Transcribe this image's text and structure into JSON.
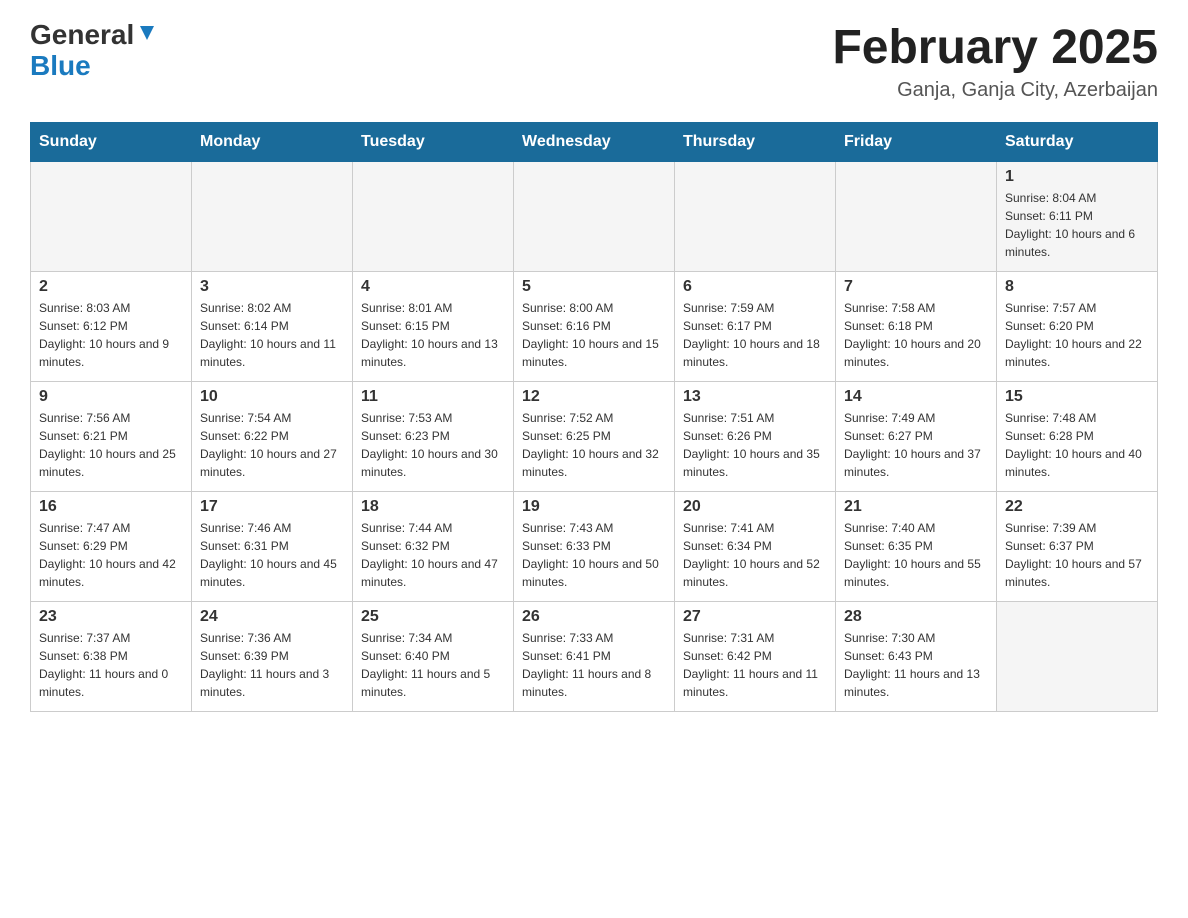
{
  "logo": {
    "general": "General",
    "blue": "Blue"
  },
  "header": {
    "month_year": "February 2025",
    "location": "Ganja, Ganja City, Azerbaijan"
  },
  "days_of_week": [
    "Sunday",
    "Monday",
    "Tuesday",
    "Wednesday",
    "Thursday",
    "Friday",
    "Saturday"
  ],
  "weeks": [
    {
      "days": [
        {
          "number": "",
          "info": ""
        },
        {
          "number": "",
          "info": ""
        },
        {
          "number": "",
          "info": ""
        },
        {
          "number": "",
          "info": ""
        },
        {
          "number": "",
          "info": ""
        },
        {
          "number": "",
          "info": ""
        },
        {
          "number": "1",
          "info": "Sunrise: 8:04 AM\nSunset: 6:11 PM\nDaylight: 10 hours and 6 minutes."
        }
      ]
    },
    {
      "days": [
        {
          "number": "2",
          "info": "Sunrise: 8:03 AM\nSunset: 6:12 PM\nDaylight: 10 hours and 9 minutes."
        },
        {
          "number": "3",
          "info": "Sunrise: 8:02 AM\nSunset: 6:14 PM\nDaylight: 10 hours and 11 minutes."
        },
        {
          "number": "4",
          "info": "Sunrise: 8:01 AM\nSunset: 6:15 PM\nDaylight: 10 hours and 13 minutes."
        },
        {
          "number": "5",
          "info": "Sunrise: 8:00 AM\nSunset: 6:16 PM\nDaylight: 10 hours and 15 minutes."
        },
        {
          "number": "6",
          "info": "Sunrise: 7:59 AM\nSunset: 6:17 PM\nDaylight: 10 hours and 18 minutes."
        },
        {
          "number": "7",
          "info": "Sunrise: 7:58 AM\nSunset: 6:18 PM\nDaylight: 10 hours and 20 minutes."
        },
        {
          "number": "8",
          "info": "Sunrise: 7:57 AM\nSunset: 6:20 PM\nDaylight: 10 hours and 22 minutes."
        }
      ]
    },
    {
      "days": [
        {
          "number": "9",
          "info": "Sunrise: 7:56 AM\nSunset: 6:21 PM\nDaylight: 10 hours and 25 minutes."
        },
        {
          "number": "10",
          "info": "Sunrise: 7:54 AM\nSunset: 6:22 PM\nDaylight: 10 hours and 27 minutes."
        },
        {
          "number": "11",
          "info": "Sunrise: 7:53 AM\nSunset: 6:23 PM\nDaylight: 10 hours and 30 minutes."
        },
        {
          "number": "12",
          "info": "Sunrise: 7:52 AM\nSunset: 6:25 PM\nDaylight: 10 hours and 32 minutes."
        },
        {
          "number": "13",
          "info": "Sunrise: 7:51 AM\nSunset: 6:26 PM\nDaylight: 10 hours and 35 minutes."
        },
        {
          "number": "14",
          "info": "Sunrise: 7:49 AM\nSunset: 6:27 PM\nDaylight: 10 hours and 37 minutes."
        },
        {
          "number": "15",
          "info": "Sunrise: 7:48 AM\nSunset: 6:28 PM\nDaylight: 10 hours and 40 minutes."
        }
      ]
    },
    {
      "days": [
        {
          "number": "16",
          "info": "Sunrise: 7:47 AM\nSunset: 6:29 PM\nDaylight: 10 hours and 42 minutes."
        },
        {
          "number": "17",
          "info": "Sunrise: 7:46 AM\nSunset: 6:31 PM\nDaylight: 10 hours and 45 minutes."
        },
        {
          "number": "18",
          "info": "Sunrise: 7:44 AM\nSunset: 6:32 PM\nDaylight: 10 hours and 47 minutes."
        },
        {
          "number": "19",
          "info": "Sunrise: 7:43 AM\nSunset: 6:33 PM\nDaylight: 10 hours and 50 minutes."
        },
        {
          "number": "20",
          "info": "Sunrise: 7:41 AM\nSunset: 6:34 PM\nDaylight: 10 hours and 52 minutes."
        },
        {
          "number": "21",
          "info": "Sunrise: 7:40 AM\nSunset: 6:35 PM\nDaylight: 10 hours and 55 minutes."
        },
        {
          "number": "22",
          "info": "Sunrise: 7:39 AM\nSunset: 6:37 PM\nDaylight: 10 hours and 57 minutes."
        }
      ]
    },
    {
      "days": [
        {
          "number": "23",
          "info": "Sunrise: 7:37 AM\nSunset: 6:38 PM\nDaylight: 11 hours and 0 minutes."
        },
        {
          "number": "24",
          "info": "Sunrise: 7:36 AM\nSunset: 6:39 PM\nDaylight: 11 hours and 3 minutes."
        },
        {
          "number": "25",
          "info": "Sunrise: 7:34 AM\nSunset: 6:40 PM\nDaylight: 11 hours and 5 minutes."
        },
        {
          "number": "26",
          "info": "Sunrise: 7:33 AM\nSunset: 6:41 PM\nDaylight: 11 hours and 8 minutes."
        },
        {
          "number": "27",
          "info": "Sunrise: 7:31 AM\nSunset: 6:42 PM\nDaylight: 11 hours and 11 minutes."
        },
        {
          "number": "28",
          "info": "Sunrise: 7:30 AM\nSunset: 6:43 PM\nDaylight: 11 hours and 13 minutes."
        },
        {
          "number": "",
          "info": ""
        }
      ]
    }
  ]
}
